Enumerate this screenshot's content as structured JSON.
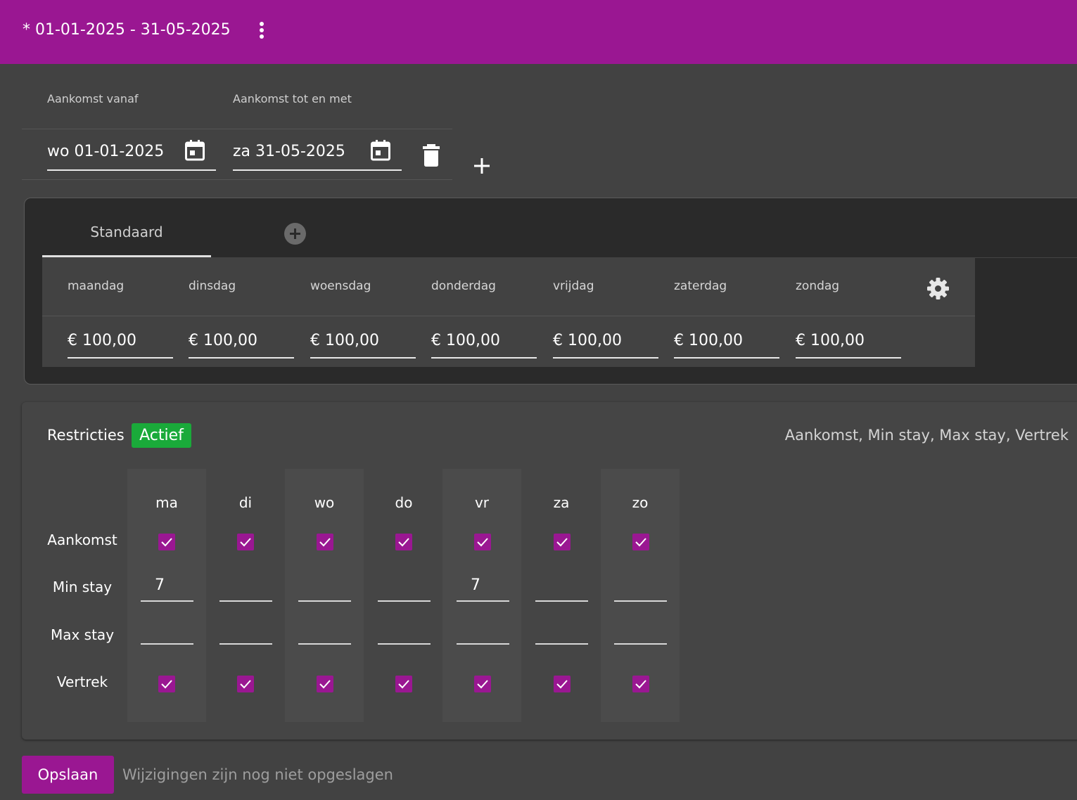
{
  "header": {
    "title": "* 01-01-2025 - 31-05-2025",
    "menu_icon": "more-vertical-icon"
  },
  "period": {
    "from_label": "Aankomst vanaf",
    "to_label": "Aankomst tot en met",
    "from_value": "wo 01-01-2025",
    "to_value": "za 31-05-2025"
  },
  "rates": {
    "tabs": [
      {
        "label": "Standaard",
        "active": true
      }
    ],
    "days": [
      {
        "label": "maandag",
        "value": "€ 100,00"
      },
      {
        "label": "dinsdag",
        "value": "€ 100,00"
      },
      {
        "label": "woensdag",
        "value": "€ 100,00"
      },
      {
        "label": "donderdag",
        "value": "€ 100,00"
      },
      {
        "label": "vrijdag",
        "value": "€ 100,00"
      },
      {
        "label": "zaterdag",
        "value": "€ 100,00"
      },
      {
        "label": "zondag",
        "value": "€ 100,00"
      }
    ]
  },
  "restrictions": {
    "title": "Restricties",
    "status": "Actief",
    "summary": "Aankomst, Min stay, Max stay, Vertrek",
    "days": [
      "ma",
      "di",
      "wo",
      "do",
      "vr",
      "za",
      "zo"
    ],
    "row_labels": {
      "arrival": "Aankomst",
      "min_stay": "Min stay",
      "max_stay": "Max stay",
      "departure": "Vertrek"
    },
    "arrival": [
      true,
      true,
      true,
      true,
      true,
      true,
      true
    ],
    "min_stay": [
      "7",
      "",
      "",
      "",
      "7",
      "",
      ""
    ],
    "max_stay": [
      "",
      "",
      "",
      "",
      "",
      "",
      ""
    ],
    "departure": [
      true,
      true,
      true,
      true,
      true,
      true,
      true
    ]
  },
  "footer": {
    "save_label": "Opslaan",
    "unsaved_text": "Wijzigingen zijn nog niet opgeslagen"
  },
  "colors": {
    "accent": "#9a1792",
    "active_badge": "#1aaa3a",
    "background": "#424242"
  }
}
